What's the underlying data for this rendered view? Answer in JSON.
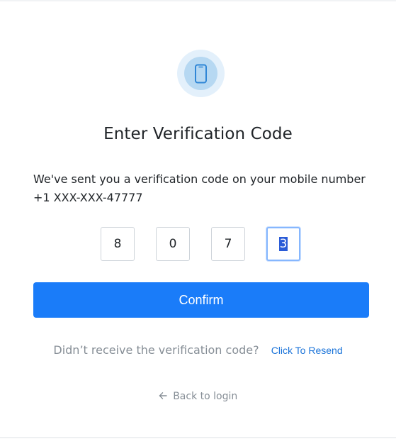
{
  "header": {
    "icon": "smartphone-icon",
    "title": "Enter Verification Code"
  },
  "message": {
    "text": "We've sent you a verification code on your mobile number +1 XXX-XXX-47777"
  },
  "otp": {
    "digits": [
      "8",
      "0",
      "7",
      "3"
    ],
    "focused_index": 3
  },
  "actions": {
    "confirm_label": "Confirm",
    "resend_question": "Didn’t receive the verification code?",
    "resend_link": "Click To Resend",
    "back_label": "Back to login",
    "back_icon": "arrow-left-icon"
  },
  "colors": {
    "primary": "#1a7cf9",
    "link": "#1a73d9",
    "muted": "#868e96",
    "icon_bg_outer": "#e3f0fb",
    "icon_bg_inner": "#b6d8f2"
  }
}
